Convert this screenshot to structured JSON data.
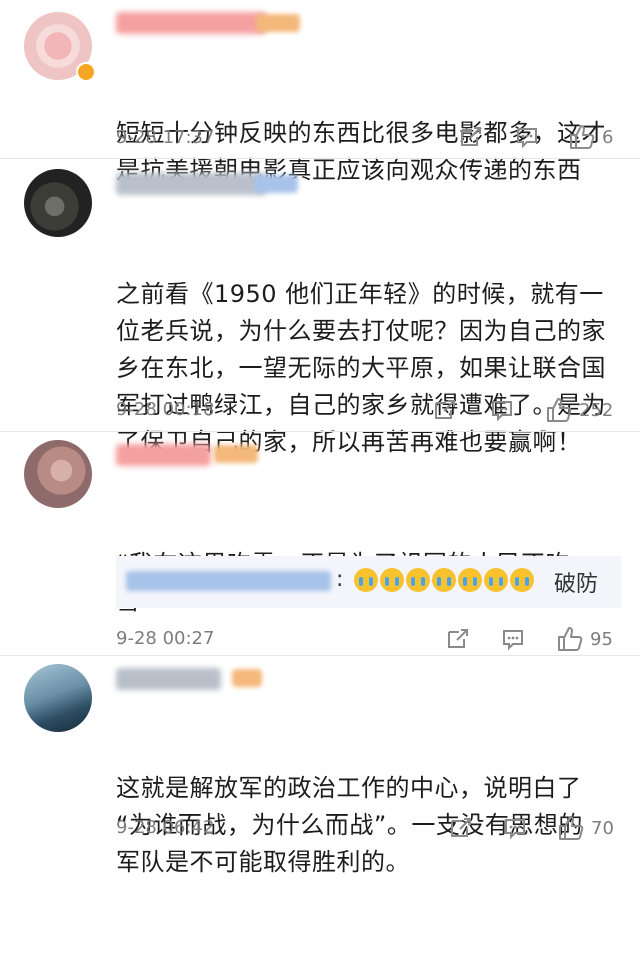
{
  "comments": [
    {
      "text": "短短十分钟反映的东西比很多电影都多，这才是抗美援朝电影真正应该向观众传递的东西",
      "lines": [
        "短短十分钟反映的东西比很多电影都多，这才",
        "是抗美援朝电影真正应该向观众传递的东西"
      ],
      "time": "9-28 17:37",
      "likes": "6"
    },
    {
      "lines": [
        "之前看《1950 他们正年轻》的时候，就有一",
        "位老兵说，为什么要去打仗呢？因为自己的家",
        "乡在东北，一望无际的大平原，如果让联合国",
        "军打过鸭绿江，自己的家乡就得遭难了。是为",
        "了保卫自己的家，所以再苦再难也要赢啊！"
      ],
      "time": "9-28 00:18",
      "likes": "252"
    },
    {
      "lines": [
        "“我在这里吃雪，正是为了祖国的人民不吃",
        "雪”"
      ],
      "reply": {
        "colon": ":",
        "text": "破防",
        "emoji_count": 7
      },
      "time": "9-28 00:27",
      "likes": "95"
    },
    {
      "lines": [
        "这就是解放军的政治工作的中心，说明白了",
        "“为谁而战，为什么而战”。一支没有思想的",
        "军队是不可能取得胜利的。"
      ],
      "time": "9-28 06:42",
      "likes": "70"
    }
  ],
  "icons": {
    "repost": "repost-icon",
    "comment": "comment-icon",
    "like": "thumbs-up-icon"
  },
  "colors": {
    "text": "#1d1d1d",
    "meta": "#7d7d7d",
    "reply_bg": "#f3f5fa",
    "username_blur_pink": "#f4a0a0",
    "username_blur_gray": "#b9c0cb"
  }
}
